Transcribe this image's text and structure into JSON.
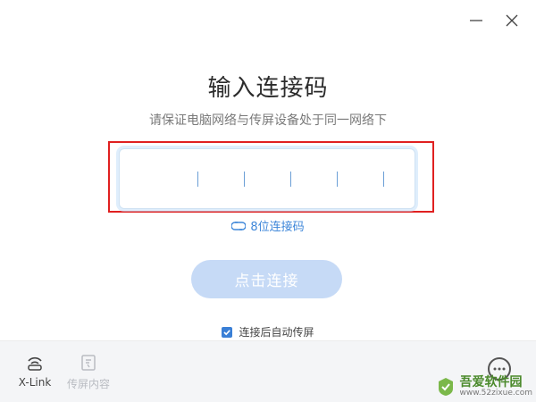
{
  "window": {
    "controls": [
      "minimize",
      "close"
    ]
  },
  "main": {
    "title": "输入连接码",
    "subtitle": "请保证电脑网络与传屏设备处于同一网络下",
    "code_slots": 6,
    "switch_link_label": "8位连接码",
    "connect_button_label": "点击连接",
    "auto_share_label": "连接后自动传屏",
    "auto_share_checked": true
  },
  "footer": {
    "xlink_label": "X-Link",
    "screen_content_label": "传屏内容"
  },
  "watermark": {
    "title": "吾爱软件园",
    "url": "www.52zixue.com"
  },
  "colors": {
    "accent": "#3d86d9",
    "button_disabled": "#c6daf6",
    "highlight_border": "#e02020"
  }
}
